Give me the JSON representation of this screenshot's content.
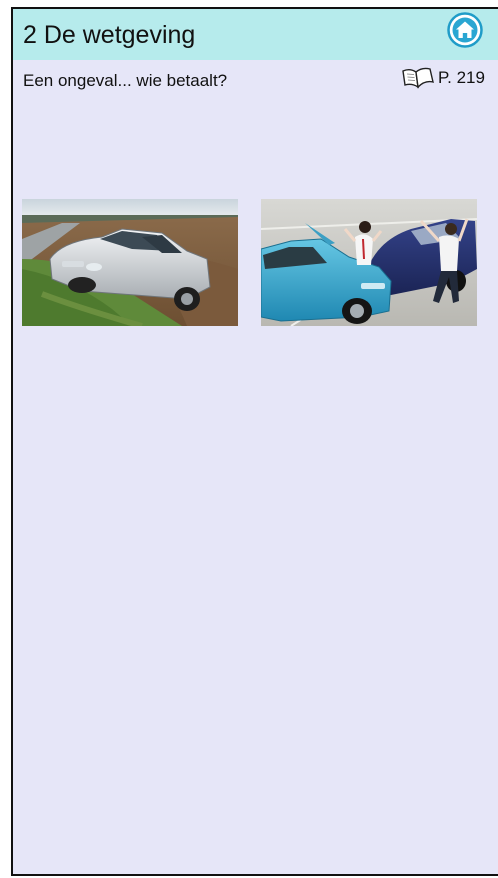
{
  "header": {
    "title": "2 De wetgeving",
    "home_icon": "home-icon"
  },
  "subtitle": "Een ongeval... wie betaalt?",
  "page_reference": {
    "icon": "open-book-icon",
    "label": "P. 219"
  },
  "images": [
    {
      "name": "car-in-ditch-photo"
    },
    {
      "name": "car-accident-argument-photo"
    }
  ],
  "colors": {
    "header_bg": "#b6ebec",
    "page_bg": "#e6e6f8",
    "home_icon": "#1f9cc8"
  }
}
